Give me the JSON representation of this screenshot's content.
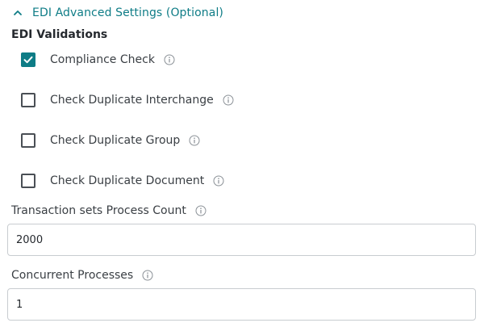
{
  "section": {
    "title": "EDI Advanced Settings (Optional)",
    "expanded": true,
    "accent_color": "#0e7c86",
    "icon": "chevron-up-icon"
  },
  "validations": {
    "title": "EDI Validations",
    "items": [
      {
        "label": "Compliance Check",
        "checked": true
      },
      {
        "label": "Check Duplicate Interchange",
        "checked": false
      },
      {
        "label": "Check Duplicate Group",
        "checked": false
      },
      {
        "label": "Check Duplicate Document",
        "checked": false
      }
    ]
  },
  "fields": {
    "transaction_sets": {
      "label": "Transaction sets Process Count",
      "value": "2000"
    },
    "concurrent": {
      "label": "Concurrent Processes",
      "value": "1"
    }
  },
  "icons": {
    "info": "info-icon",
    "check": "checkmark-icon"
  }
}
